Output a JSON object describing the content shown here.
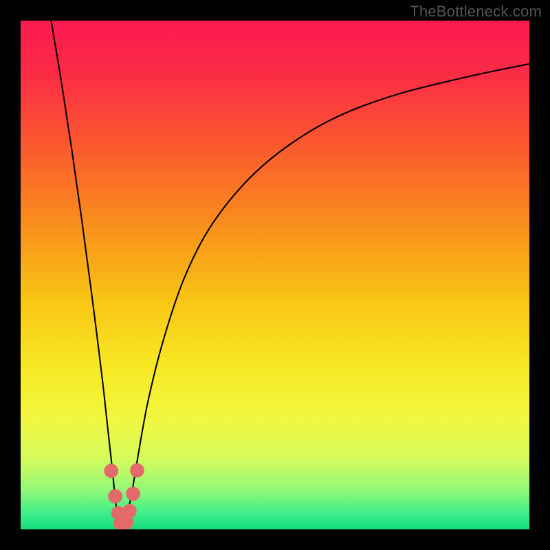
{
  "watermark": "TheBottleneck.com",
  "colors": {
    "black": "#000000",
    "curve": "#000000",
    "marker": "#e46a6a",
    "gradient_stops": [
      {
        "offset": 0,
        "color": "#fb1a50"
      },
      {
        "offset": 0.1,
        "color": "#fb2a46"
      },
      {
        "offset": 0.25,
        "color": "#fa5a2d"
      },
      {
        "offset": 0.4,
        "color": "#f98e1c"
      },
      {
        "offset": 0.55,
        "color": "#f8c514"
      },
      {
        "offset": 0.68,
        "color": "#f7e824"
      },
      {
        "offset": 0.78,
        "color": "#f2f73f"
      },
      {
        "offset": 0.86,
        "color": "#d6fa5a"
      },
      {
        "offset": 0.92,
        "color": "#95f977"
      },
      {
        "offset": 0.97,
        "color": "#3dee8a"
      },
      {
        "offset": 1.0,
        "color": "#14dc7c"
      }
    ]
  },
  "chart_data": {
    "type": "line",
    "title": "",
    "xlabel": "",
    "ylabel": "",
    "xlim": [
      0,
      100
    ],
    "ylim": [
      0,
      100
    ],
    "grid": false,
    "series": [
      {
        "name": "bottleneck-curve",
        "x": [
          6,
          8,
          10,
          12,
          14,
          16,
          17,
          18,
          18.5,
          19,
          19.5,
          20,
          20.5,
          21,
          22,
          23,
          25,
          28,
          32,
          37,
          44,
          52,
          62,
          74,
          88,
          100
        ],
        "y": [
          100,
          88,
          75,
          61,
          46,
          30,
          21,
          12,
          7,
          3,
          1,
          0.3,
          1,
          3,
          8,
          14,
          25,
          37,
          49,
          59,
          68,
          75,
          81,
          85.5,
          89,
          91.5
        ]
      }
    ],
    "markers": {
      "name": "highlight-dots",
      "x": [
        17.8,
        18.6,
        19.2,
        19.7,
        20.2,
        20.8,
        21.4,
        22.1,
        22.9
      ],
      "y": [
        11.5,
        6.5,
        3.2,
        1.2,
        0.6,
        1.4,
        3.6,
        7.0,
        11.6
      ],
      "r": 1.4
    }
  }
}
